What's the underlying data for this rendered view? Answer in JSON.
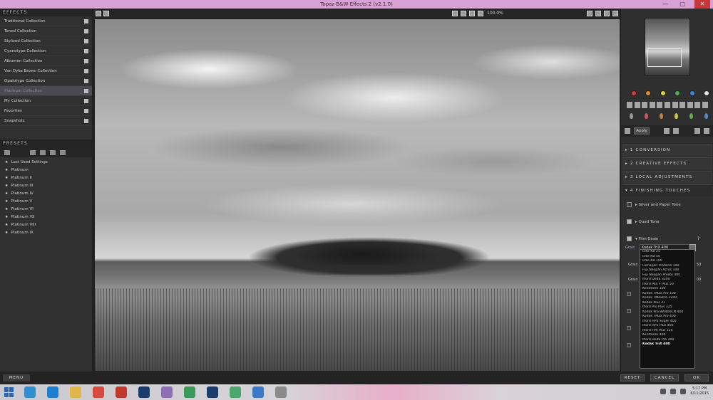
{
  "window": {
    "title": "Topaz B&W Effects 2 (v2.1.0)",
    "controls": [
      "—",
      "□",
      "✕"
    ]
  },
  "effects": {
    "header": "EFFECTS",
    "collections": [
      {
        "label": "Traditional Collection",
        "active": false
      },
      {
        "label": "Toned Collection",
        "active": false
      },
      {
        "label": "Stylized Collection",
        "active": false
      },
      {
        "label": "Cyanotype Collection",
        "active": false
      },
      {
        "label": "Albumen Collection",
        "active": false
      },
      {
        "label": "Van Dyke Brown Collection",
        "active": false
      },
      {
        "label": "Opalotype Collection",
        "active": false
      },
      {
        "label": "Platinum Collection",
        "active": true
      },
      {
        "label": "My Collection",
        "active": false
      },
      {
        "label": "Favorites",
        "active": false
      },
      {
        "label": "Snapshots",
        "active": false
      }
    ]
  },
  "presets": {
    "header": "PRESETS",
    "items": [
      "Last Used Settings",
      "Platinum",
      "Platinum II",
      "Platinum III",
      "Platinum IV",
      "Platinum V",
      "Platinum VI",
      "Platinum VII",
      "Platinum VIII",
      "Platinum IX"
    ]
  },
  "toolbar": {
    "zoom": "100.0%"
  },
  "right_panel": {
    "swatch_colors": [
      "#d63b3b",
      "#e38a2b",
      "#e2d23a",
      "#4caf50",
      "#3f86d8",
      "#e6e6e6"
    ],
    "drop_colors": [
      "#9a9a9a",
      "#c65a5a",
      "#c97d3a",
      "#d2c24a",
      "#6aa84f",
      "#5a88c8"
    ],
    "apply_label": "Apply",
    "sections": [
      {
        "label": "▸ 1  CONVERSION"
      },
      {
        "label": "▸ 2  CREATIVE EFFECTS"
      },
      {
        "label": "▸ 3  LOCAL ADJUSTMENTS"
      },
      {
        "label": "▾ 4  FINISHING TOUCHES"
      }
    ],
    "finishing": {
      "silver_paper": "▸  Silver and Paper Tone",
      "quad_tone": "▸  Quad Tone",
      "film_grain": "▾  Film Grain",
      "help": "?",
      "type_label": "Grain",
      "selected_film": "Kodak TriX 400",
      "hidden_rows": [
        {
          "label": "Grain",
          "value": "50"
        },
        {
          "label": "Grain",
          "value": "00"
        }
      ]
    },
    "film_options": [
      "Efke KB 25",
      "Efke KB 50",
      "Efke KB 100",
      "Fomapan Profiline 100",
      "Fuji Neopan Acros 100",
      "Fuji Neopan Presto 400",
      "Ilford Delta 3200",
      "Ilford Pan F Plus 50",
      "Kentmere 100",
      "Kodak TMax Pro 100",
      "Kodak TMaxPro 3200",
      "Kodak Plus 21",
      "Ilford Pro Plus 125",
      "Kodak Pro BW400CN 400",
      "Kodak TMax Pro 400",
      "Ilford HP5 Super 400",
      "Ilford HP5 Plus 400",
      "Ilford FP4 Plus 125",
      "Kentmere 400",
      "Ilford Delta Pro 400",
      "Kodak TriX 400"
    ]
  },
  "bottom": {
    "menu": "MENU",
    "reset": "RESET",
    "cancel": "CANCEL",
    "ok": "OK"
  },
  "taskbar": {
    "apps": [
      {
        "name": "explorer",
        "color": "#2f8fd1"
      },
      {
        "name": "ie",
        "color": "#1e7fd1"
      },
      {
        "name": "folder",
        "color": "#e0b64a"
      },
      {
        "name": "chrome",
        "color": "#d94a3a"
      },
      {
        "name": "media",
        "color": "#c0392b"
      },
      {
        "name": "photoshop",
        "color": "#1c3c6e"
      },
      {
        "name": "paint",
        "color": "#8e6fb5"
      },
      {
        "name": "calc",
        "color": "#3a9a5a"
      },
      {
        "name": "photoshop2",
        "color": "#1c3c6e"
      },
      {
        "name": "app",
        "color": "#4aa86a"
      },
      {
        "name": "snowflake",
        "color": "#3a78c8"
      },
      {
        "name": "target",
        "color": "#8a8a8a"
      }
    ],
    "time": "5:17 PM",
    "date": "6/11/2015"
  }
}
